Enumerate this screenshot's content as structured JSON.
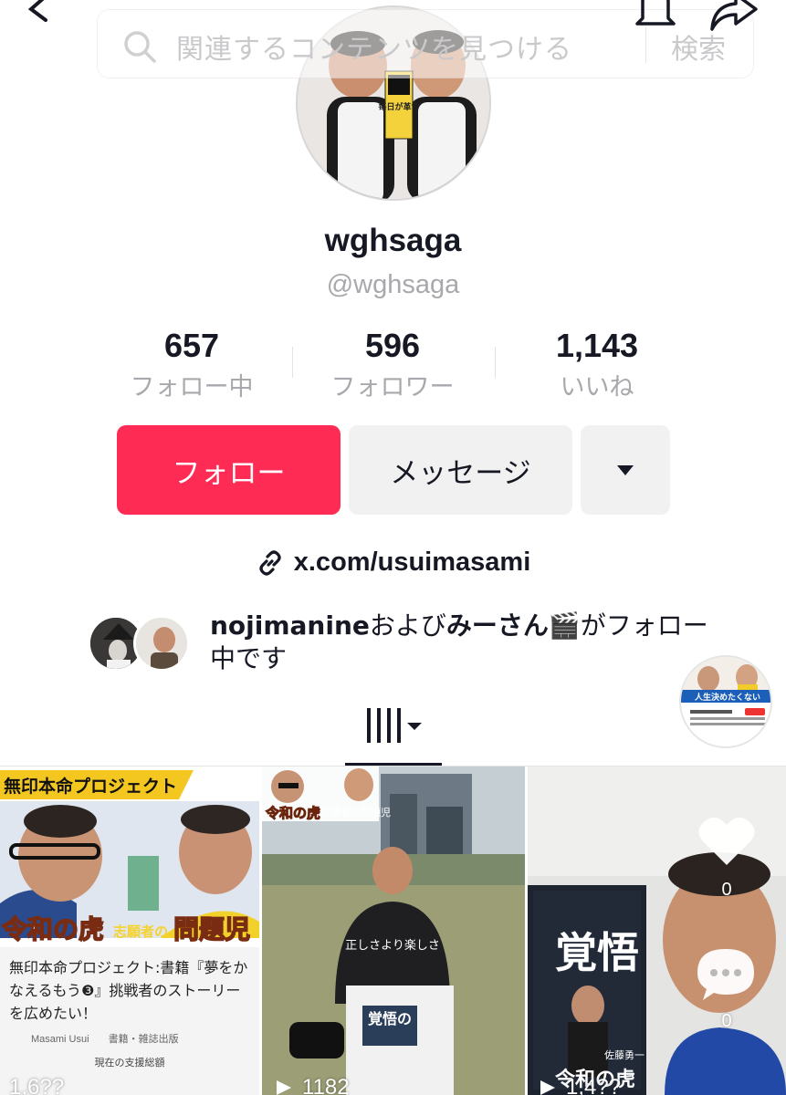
{
  "header": {
    "search_placeholder": "関連するコンテンツを見つける",
    "search_button": "検索"
  },
  "profile": {
    "display_name": "wghsaga",
    "handle": "@wghsaga",
    "avatar_book_title": "毎日が革命"
  },
  "stats": [
    {
      "value": "657",
      "label": "フォロー中"
    },
    {
      "value": "596",
      "label": "フォロワー"
    },
    {
      "value": "1,143",
      "label": "いいね"
    }
  ],
  "actions": {
    "follow_label": "フォロー",
    "message_label": "メッセージ"
  },
  "bio_link": "x.com/usuimasami",
  "followed_by": {
    "name1": "nojimanine",
    "joiner": "および",
    "name2": "みーさん🎬",
    "suffix": "がフォロー中です"
  },
  "pip": {
    "banner_text": "人生決めたくない"
  },
  "videos": [
    {
      "banner": "無印本命プロジェクト",
      "headline": "令和の虎",
      "headline_sub": "志願者の",
      "headline_end": "問題児",
      "project_title": "無印本命プロジェクト:書籍『夢をかなえるもう❸』挑戦者のストーリーを広めたい！",
      "author": "Masami Usui",
      "category": "書籍・雑誌出版",
      "support_label": "現在の支援総額",
      "views": "1,6??"
    },
    {
      "overlay_title": "令和の虎",
      "overlay_sub": "志願者の問題児",
      "shirt_text": "正しさより楽しさ",
      "book_text": "覚悟の",
      "views": "1182"
    },
    {
      "book_title": "覚悟",
      "book_author": "佐藤勇一",
      "book_bottom": "令和の虎",
      "like_count": "0",
      "comment_count": "0",
      "views": "1,4??"
    }
  ]
}
